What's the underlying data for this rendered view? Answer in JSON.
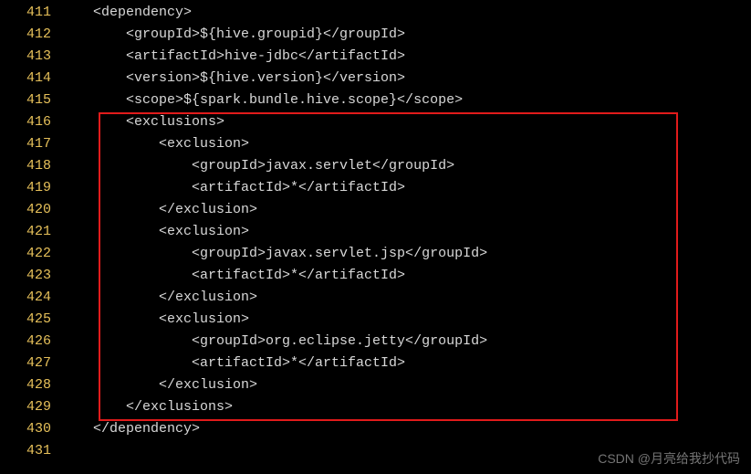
{
  "line_numbers": [
    "411",
    "412",
    "413",
    "414",
    "415",
    "416",
    "417",
    "418",
    "419",
    "420",
    "421",
    "422",
    "423",
    "424",
    "425",
    "426",
    "427",
    "428",
    "429",
    "430",
    "431"
  ],
  "code_lines": {
    "l411": "    <dependency>",
    "l412": "        <groupId>${hive.groupid}</groupId>",
    "l413": "        <artifactId>hive-jdbc</artifactId>",
    "l414": "        <version>${hive.version}</version>",
    "l415": "        <scope>${spark.bundle.hive.scope}</scope>",
    "l416": "        <exclusions>",
    "l417": "            <exclusion>",
    "l418": "                <groupId>javax.servlet</groupId>",
    "l419": "                <artifactId>*</artifactId>",
    "l420": "            </exclusion>",
    "l421": "            <exclusion>",
    "l422": "                <groupId>javax.servlet.jsp</groupId>",
    "l423": "                <artifactId>*</artifactId>",
    "l424": "            </exclusion>",
    "l425": "            <exclusion>",
    "l426": "                <groupId>org.eclipse.jetty</groupId>",
    "l427": "                <artifactId>*</artifactId>",
    "l428": "            </exclusion>",
    "l429": "        </exclusions>",
    "l430": "    </dependency>",
    "l431": ""
  },
  "watermark": "CSDN @月亮给我抄代码"
}
